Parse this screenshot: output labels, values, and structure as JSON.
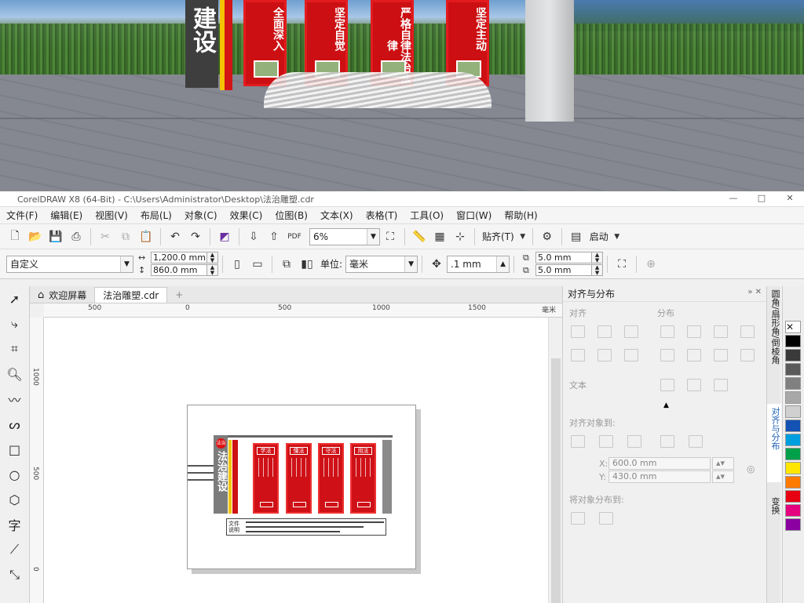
{
  "photo": {
    "sign_big_text": "建设",
    "columns": [
      {
        "text": "全面深入"
      },
      {
        "text": "坚定自觉"
      },
      {
        "text": "严格自律法治法律"
      },
      {
        "text": "坚定主动"
      }
    ]
  },
  "window": {
    "title": "CorelDRAW X8 (64-Bit) - C:\\Users\\Administrator\\Desktop\\法治雕塑.cdr",
    "min": "—",
    "max": "□",
    "close": "✕"
  },
  "menu": [
    "文件(F)",
    "编辑(E)",
    "视图(V)",
    "布局(L)",
    "对象(C)",
    "效果(C)",
    "位图(B)",
    "文本(X)",
    "表格(T)",
    "工具(O)",
    "窗口(W)",
    "帮助(H)"
  ],
  "toolbar": {
    "zoom": "6%",
    "snap_label": "贴齐(T)",
    "launch_label": "启动",
    "pdf_label": "PDF"
  },
  "propbar": {
    "preset": "自定义",
    "width": "1,200.0 mm",
    "height": "860.0 mm",
    "unit_label": "单位:",
    "unit": "毫米",
    "nudge": ".1 mm",
    "dup_x": "5.0 mm",
    "dup_y": "5.0 mm"
  },
  "tabs": {
    "welcome": "欢迎屏幕",
    "doc": "法治雕塑.cdr",
    "add": "+"
  },
  "ruler": {
    "h": [
      "500",
      "0",
      "500",
      "1000",
      "1500",
      "毫米"
    ],
    "v": [
      "1000",
      "500",
      "0"
    ]
  },
  "artwork": {
    "logo": "法治",
    "vertical": "法治建设",
    "columns": [
      "学法",
      "懂法",
      "守法",
      "用法"
    ],
    "plaque_label": "文件说明"
  },
  "docker": {
    "title": "对齐与分布",
    "sec_align": "对齐",
    "sec_distribute": "分布",
    "sec_text": "文本",
    "sec_align_to": "对齐对象到:",
    "x_label": "X:",
    "x_value": "600.0 mm",
    "y_label": "Y:",
    "y_value": "430.0 mm",
    "sec_distribute_to": "将对象分布到:"
  },
  "vtabs": [
    "圆角/扇形角/倒棱角",
    "对齐与分布",
    "变换"
  ],
  "palette": [
    "#ffffff",
    "#000000",
    "#3a3a3a",
    "#5a5a5a",
    "#808080",
    "#a8a8a8",
    "#d0d0d0",
    "#1452b4",
    "#00a0e0",
    "#00a04a",
    "#ffe600",
    "#ff7a00",
    "#e60012",
    "#e4007f",
    "#8a00a0"
  ]
}
